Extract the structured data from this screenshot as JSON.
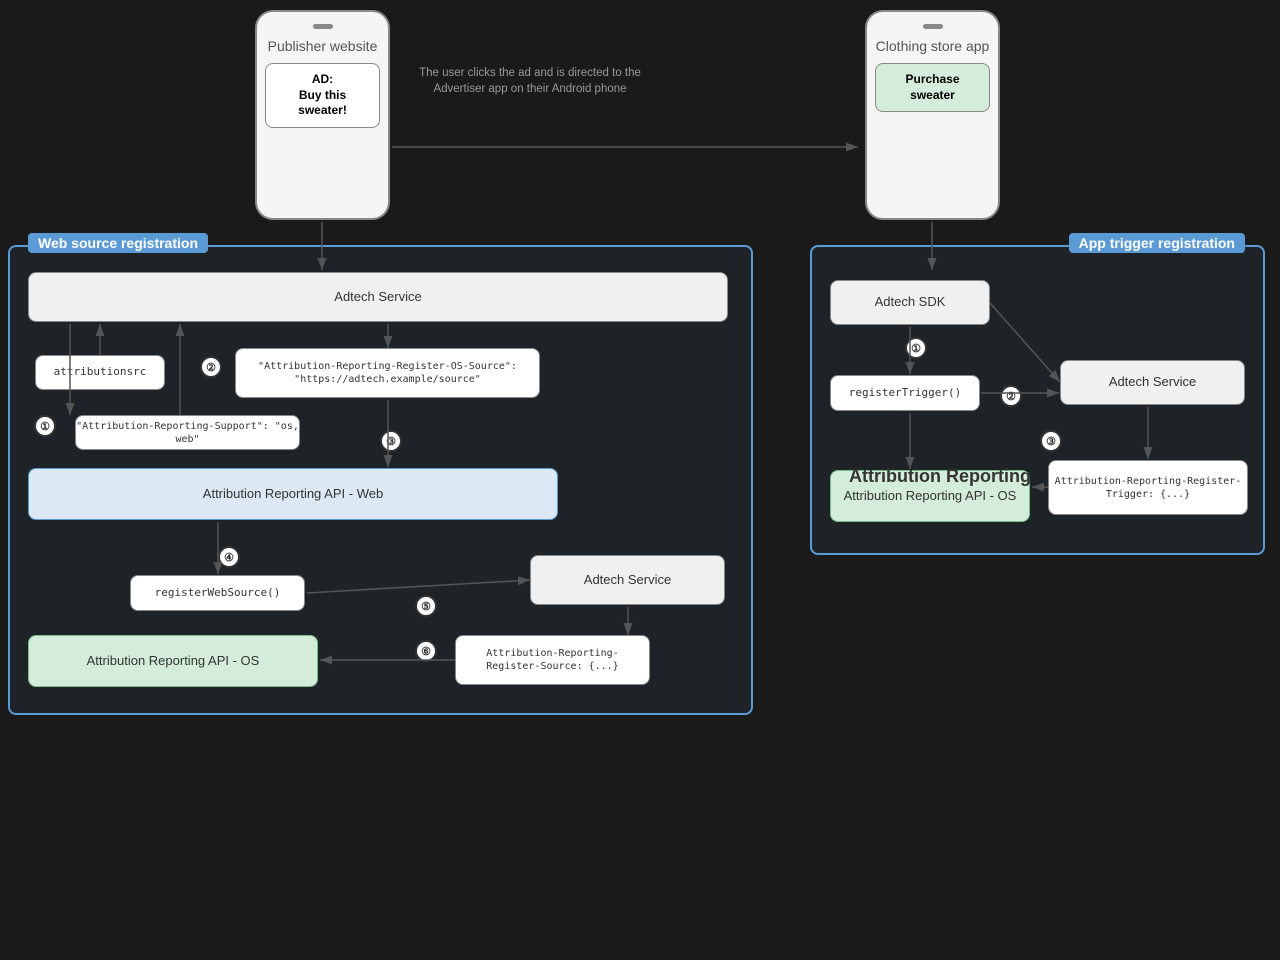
{
  "publisher_phone": {
    "title": "Publisher website",
    "ad_button_line1": "AD:",
    "ad_button_line2": "Buy this sweater!"
  },
  "clothing_phone": {
    "title": "Clothing store app",
    "button": "Purchase sweater"
  },
  "center_annotation": "The user clicks the ad and is directed to the Advertiser app on their Android phone",
  "web_source_box": {
    "label": "Web source registration"
  },
  "app_trigger_box": {
    "label": "App trigger registration"
  },
  "left_adtech_service": "Adtech Service",
  "attributionsrc_label": "attributionsrc",
  "attribution_reporting_header": "\"Attribution-Reporting-Register-OS-Source\": \"https://adtech.example/source\"",
  "attribution_support_header": "\"Attribution-Reporting-Support\": \"os, web\"",
  "attribution_api_web": "Attribution Reporting API - Web",
  "register_web_source": "registerWebSource()",
  "adtech_service_bottom": "Adtech Service",
  "attribution_register_source": "Attribution-Reporting-\nRegister-Source: {...}",
  "attribution_api_os": "Attribution Reporting API - OS",
  "right_adtech_sdk": "Adtech SDK",
  "register_trigger": "registerTrigger()",
  "right_adtech_service": "Adtech Service",
  "right_attr_api_os": "Attribution Reporting API - OS",
  "right_attr_register_trigger": "Attribution-Reporting-Register-\nTrigger: {...}",
  "attribution_reporting_center": "Attribution Reporting",
  "steps": {
    "left_1": "①",
    "left_2": "②",
    "left_3": "③",
    "left_4": "④",
    "left_5": "⑤",
    "left_6": "⑥",
    "right_1": "①",
    "right_2": "②",
    "right_3": "③"
  }
}
